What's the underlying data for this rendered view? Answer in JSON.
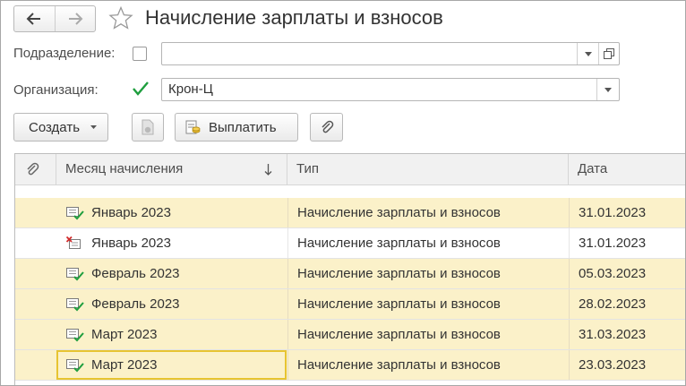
{
  "window": {
    "title": "Начисление зарплаты и взносов"
  },
  "icons": {
    "back": "arrow-left-icon",
    "forward": "arrow-right-icon",
    "favorite": "star-icon",
    "dropdown": "chevron-down-icon",
    "open": "open-window-icon",
    "add_from": "create-from-document-icon",
    "pay": "payment-icon",
    "attach": "paperclip-icon",
    "doc_posted": "document-posted-icon",
    "doc_deleted": "document-marked-deleted-icon"
  },
  "filters": {
    "department": {
      "label": "Подразделение:",
      "checked": false,
      "value": ""
    },
    "organization": {
      "label": "Организация:",
      "checked": true,
      "value": "Крон-Ц"
    }
  },
  "toolbar": {
    "create_label": "Создать",
    "pay_label": "Выплатить"
  },
  "table": {
    "columns": [
      {
        "key": "month",
        "label": "Месяц начисления",
        "sort": "desc"
      },
      {
        "key": "type",
        "label": "Тип"
      },
      {
        "key": "date",
        "label": "Дата"
      }
    ],
    "rows": [
      {
        "month": "Январь 2023",
        "type": "Начисление зарплаты и взносов",
        "date": "31.01.2023",
        "status": "posted"
      },
      {
        "month": "Январь 2023",
        "type": "Начисление зарплаты и взносов",
        "date": "31.01.2023",
        "status": "deleted"
      },
      {
        "month": "Февраль 2023",
        "type": "Начисление зарплаты и взносов",
        "date": "05.03.2023",
        "status": "posted"
      },
      {
        "month": "Февраль 2023",
        "type": "Начисление зарплаты и взносов",
        "date": "28.02.2023",
        "status": "posted"
      },
      {
        "month": "Март 2023",
        "type": "Начисление зарплаты и взносов",
        "date": "31.03.2023",
        "status": "posted"
      },
      {
        "month": "Март 2023",
        "type": "Начисление зарплаты и взносов",
        "date": "23.03.2023",
        "status": "posted",
        "selected": true
      }
    ]
  },
  "colors": {
    "row_highlight": "#fbf1c9",
    "focus_border": "#e7c431",
    "check_green": "#1e9e3e",
    "delete_red": "#d12b2b"
  }
}
